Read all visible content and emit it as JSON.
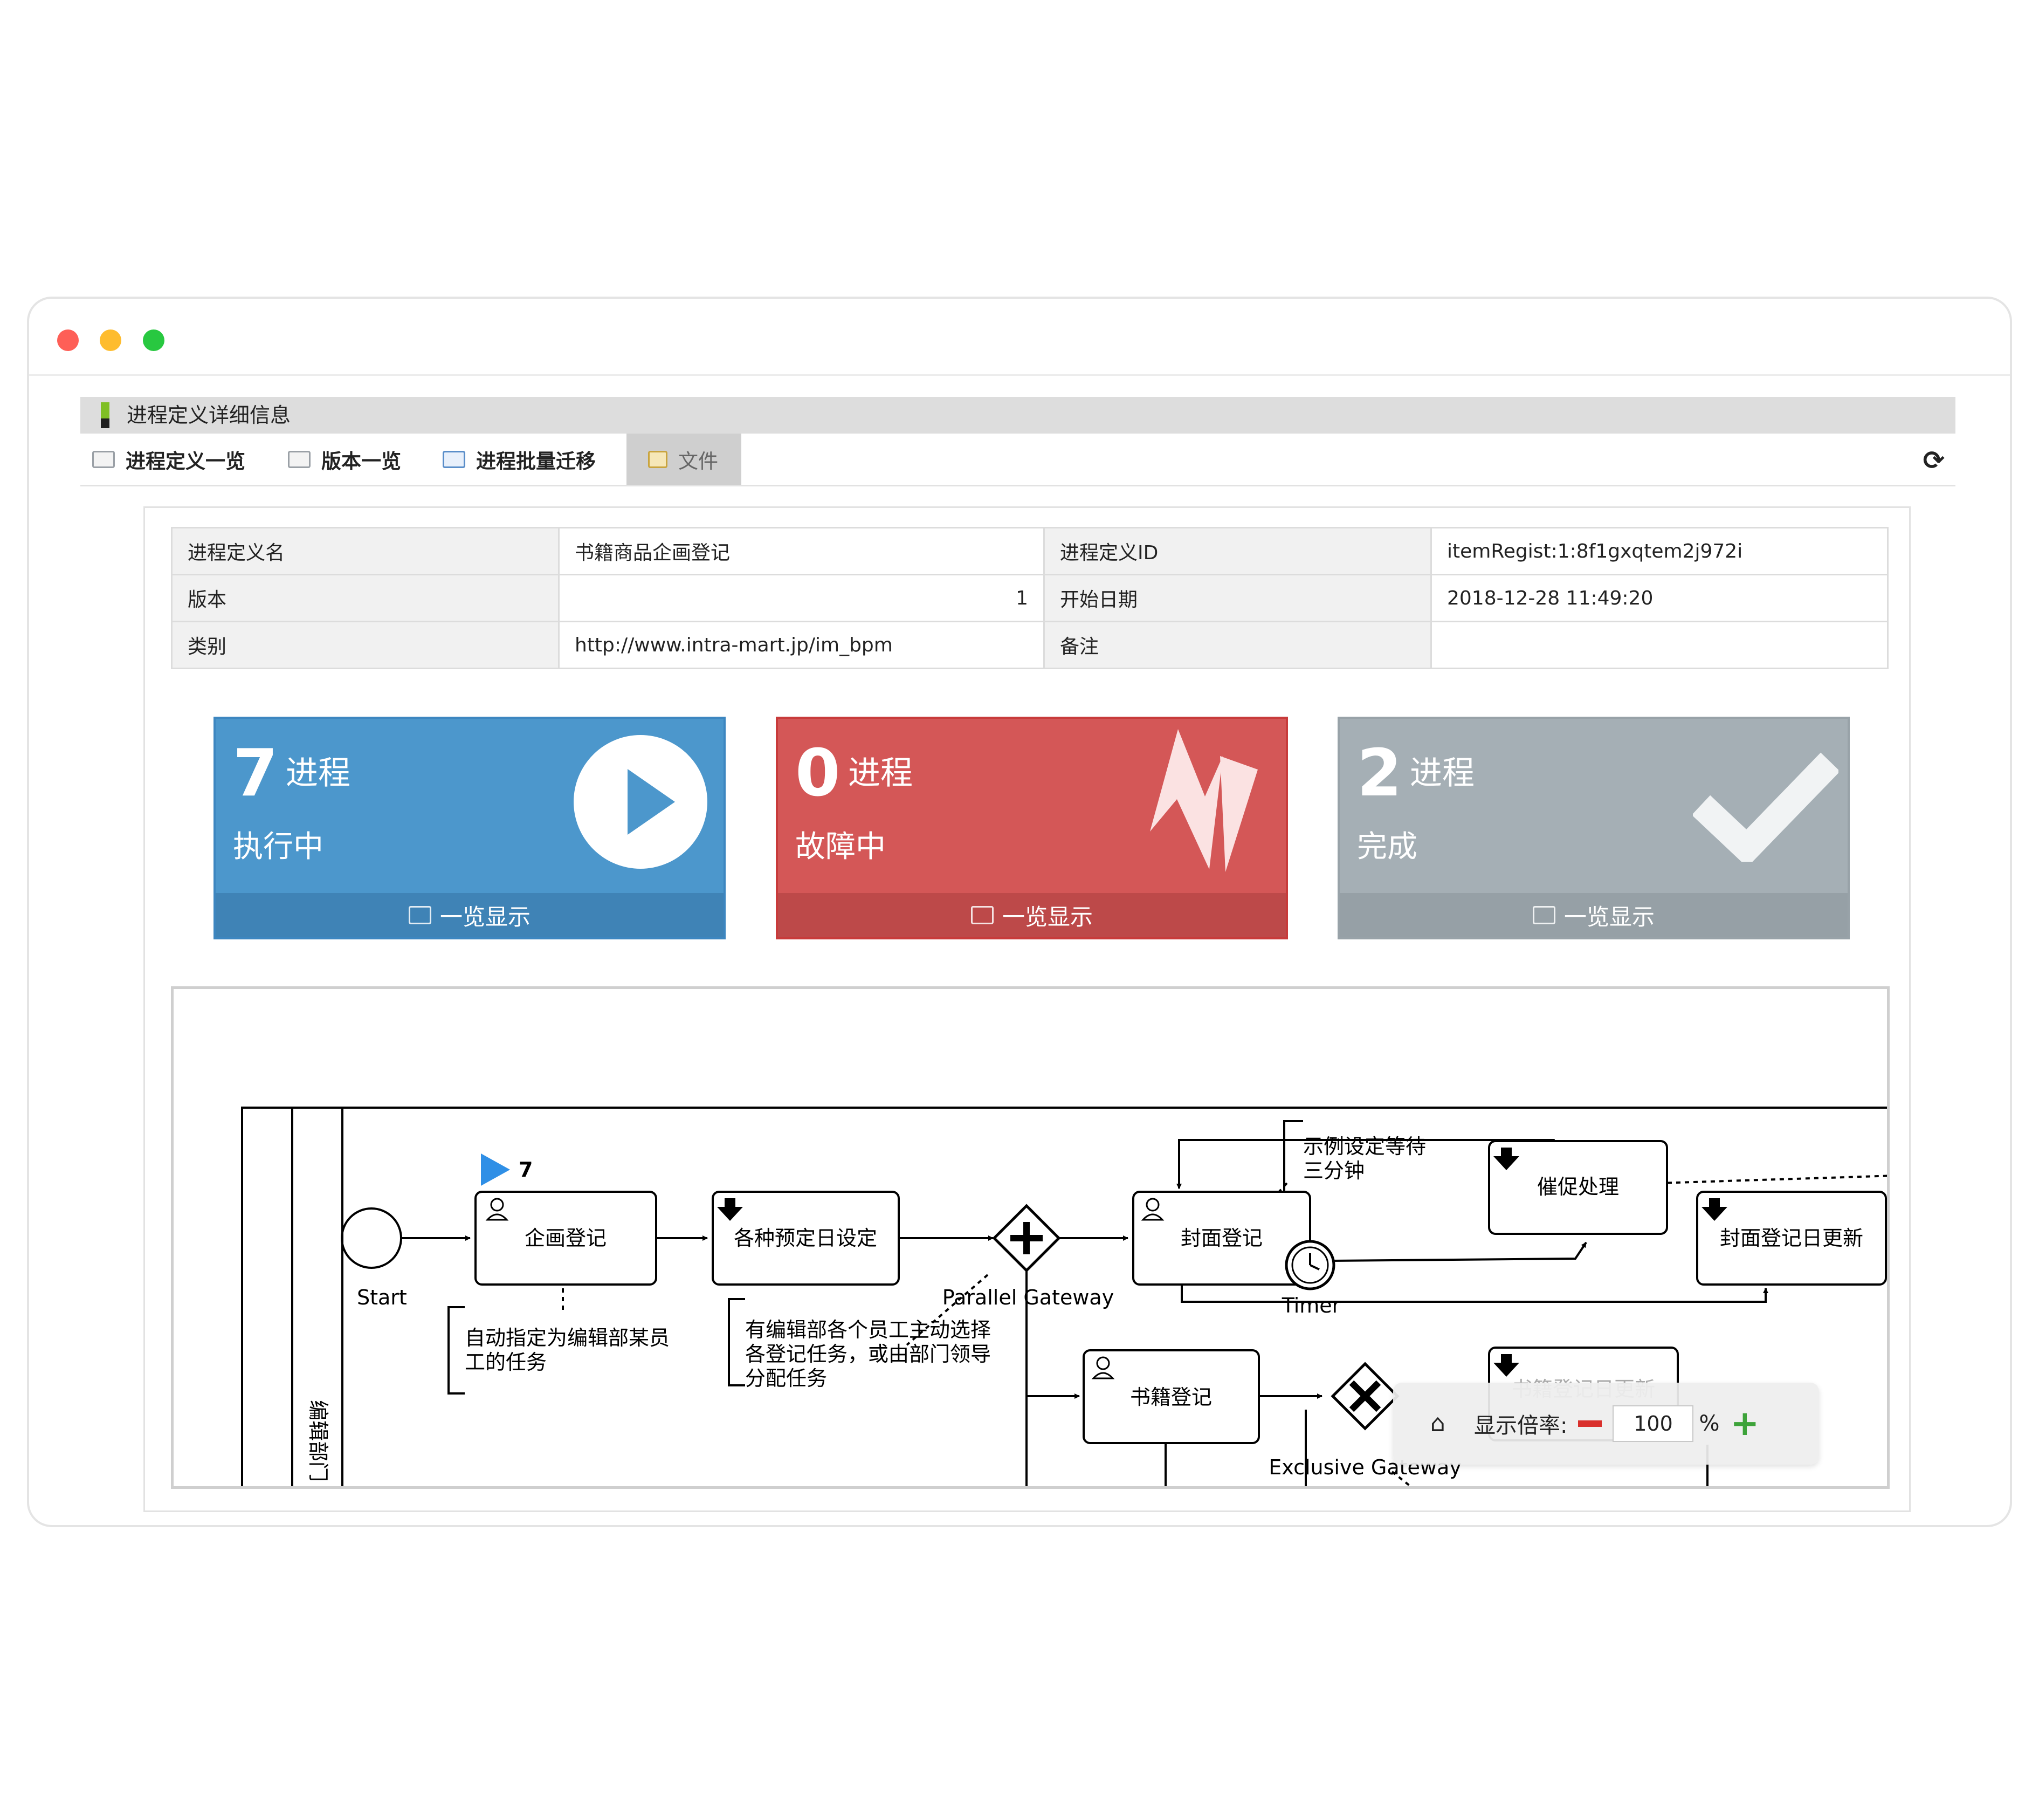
{
  "window_controls": {
    "close_color": "#fe5f57",
    "minimize_color": "#febc2e",
    "maximize_color": "#28c840"
  },
  "header": {
    "title": "进程定义详细信息"
  },
  "toolbar": {
    "tabs": [
      {
        "label": "进程定义一览",
        "icon": "list-icon"
      },
      {
        "label": "版本一览",
        "icon": "list-icon"
      },
      {
        "label": "进程批量迁移",
        "icon": "migrate-icon"
      },
      {
        "label": "文件",
        "icon": "file-icon",
        "active": true
      }
    ],
    "refresh_icon": "refresh-icon"
  },
  "info": {
    "rows": [
      {
        "label1": "进程定义名",
        "value1": "书籍商品企画登记",
        "label2": "进程定义ID",
        "value2": "itemRegist:1:8f1gxqtem2j972i"
      },
      {
        "label1": "版本",
        "value1": "1",
        "label2": "开始日期",
        "value2": "2018-12-28 11:49:20"
      },
      {
        "label1": "类别",
        "value1": "http://www.intra-mart.jp/im_bpm",
        "label2": "备注",
        "value2": ""
      }
    ]
  },
  "cards": [
    {
      "count": "7",
      "unit": "进程",
      "status": "执行中",
      "footer": "一览显示",
      "color": "#4c97cc",
      "footer_color": "#3f83b6",
      "icon": "play-icon"
    },
    {
      "count": "0",
      "unit": "进程",
      "status": "故障中",
      "footer": "一览显示",
      "color": "#d45757",
      "footer_color": "#bd4949",
      "icon": "lightning-icon"
    },
    {
      "count": "2",
      "unit": "进程",
      "status": "完成",
      "footer": "一览显示",
      "color": "#a5afb5",
      "footer_color": "#96a0a6",
      "icon": "check-icon"
    }
  ],
  "diagram": {
    "lane_label": "编辑部门",
    "start_label": "Start",
    "token_count": "7",
    "tasks": {
      "planning": "企画登记",
      "schedule": "各种预定日设定",
      "cover": "封面登记",
      "remind": "催促处理",
      "cover_update": "封面登记日更新",
      "book": "书籍登记",
      "book_update": "书籍登记日更新"
    },
    "gateways": {
      "parallel": "Parallel Gateway",
      "exclusive": "Exclusive Gateway"
    },
    "timer_label": "Timer",
    "annotations": {
      "auto_assign_1": "自动指定为编辑部某员",
      "auto_assign_2": "工的任务",
      "manual_1": "有编辑部各个员工主动选择",
      "manual_2": "各登记任务，或由部门领导",
      "manual_3": "分配任务",
      "wait_1": "示例设定等待",
      "wait_2": "三分钟"
    },
    "zoom": {
      "label": "显示倍率:",
      "value": "100",
      "unit": "%"
    }
  }
}
